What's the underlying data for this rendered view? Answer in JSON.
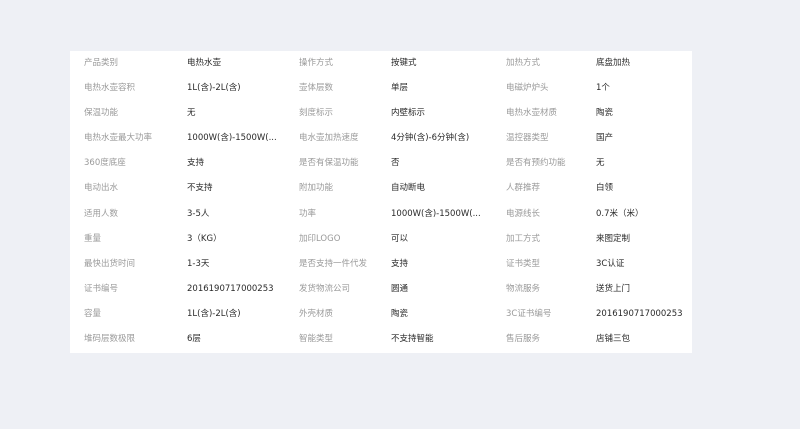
{
  "specs": {
    "rows": [
      [
        {
          "label": "产品类别",
          "value": "电热水壶"
        },
        {
          "label": "操作方式",
          "value": "按键式"
        },
        {
          "label": "加热方式",
          "value": "底盘加热"
        }
      ],
      [
        {
          "label": "电热水壶容积",
          "value": "1L(含)-2L(含)"
        },
        {
          "label": "壶体层数",
          "value": "单层"
        },
        {
          "label": "电磁炉炉头",
          "value": "1个"
        }
      ],
      [
        {
          "label": "保温功能",
          "value": "无"
        },
        {
          "label": "刻度标示",
          "value": "内壁标示"
        },
        {
          "label": "电热水壶材质",
          "value": "陶瓷"
        }
      ],
      [
        {
          "label": "电热水壶最大功率",
          "value": "1000W(含)-1500W(..."
        },
        {
          "label": "电水壶加热速度",
          "value": "4分钟(含)-6分钟(含)"
        },
        {
          "label": "温控器类型",
          "value": "国产"
        }
      ],
      [
        {
          "label": "360度底座",
          "value": "支持"
        },
        {
          "label": "是否有保温功能",
          "value": "否"
        },
        {
          "label": "是否有预约功能",
          "value": "无"
        }
      ],
      [
        {
          "label": "电动出水",
          "value": "不支持"
        },
        {
          "label": "附加功能",
          "value": "自动断电"
        },
        {
          "label": "人群推荐",
          "value": "白领"
        }
      ],
      [
        {
          "label": "适用人数",
          "value": "3-5人"
        },
        {
          "label": "功率",
          "value": "1000W(含)-1500W(..."
        },
        {
          "label": "电源线长",
          "value": "0.7米（米）"
        }
      ],
      [
        {
          "label": "重量",
          "value": "3（KG）"
        },
        {
          "label": "加印LOGO",
          "value": "可以"
        },
        {
          "label": "加工方式",
          "value": "来图定制"
        }
      ],
      [
        {
          "label": "最快出货时间",
          "value": "1-3天"
        },
        {
          "label": "是否支持一件代发",
          "value": "支持"
        },
        {
          "label": "证书类型",
          "value": "3C认证"
        }
      ],
      [
        {
          "label": "证书编号",
          "value": "2016190717000253"
        },
        {
          "label": "发货物流公司",
          "value": "圆通"
        },
        {
          "label": "物流服务",
          "value": "送货上门"
        }
      ],
      [
        {
          "label": "容量",
          "value": "1L(含)-2L(含)"
        },
        {
          "label": "外壳材质",
          "value": "陶瓷"
        },
        {
          "label": "3C证书编号",
          "value": "2016190717000253"
        }
      ],
      [
        {
          "label": "堆码层数极限",
          "value": "6层"
        },
        {
          "label": "智能类型",
          "value": "不支持智能"
        },
        {
          "label": "售后服务",
          "value": "店铺三包"
        }
      ]
    ]
  }
}
